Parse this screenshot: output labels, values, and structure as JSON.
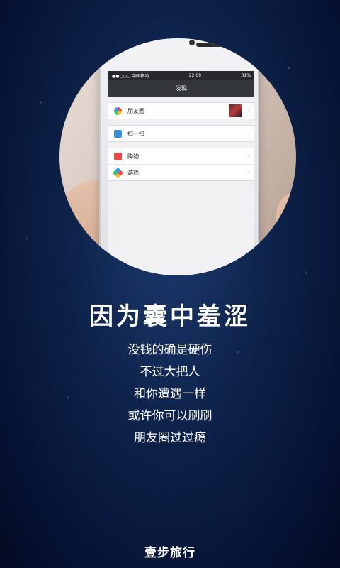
{
  "phone": {
    "status": {
      "carrier": "●●○○○ 中国移动",
      "time": "22:09",
      "battery": "31%"
    },
    "nav_title": "发现",
    "menu": [
      {
        "label": "朋友圈",
        "icon": "moments-icon"
      },
      {
        "label": "扫一扫",
        "icon": "scan-icon"
      },
      {
        "label": "购物",
        "icon": "shopping-icon"
      },
      {
        "label": "游戏",
        "icon": "game-icon"
      }
    ]
  },
  "headline": "因为囊中羞涩",
  "lines": [
    "没钱的确是硬伤",
    "不过大把人",
    "和你遭遇一样",
    "或许你可以刷刷",
    "朋友圈过过瘾"
  ],
  "brand": "壹步旅行",
  "colors": {
    "background": "#0d2148",
    "text": "#ffffff"
  }
}
